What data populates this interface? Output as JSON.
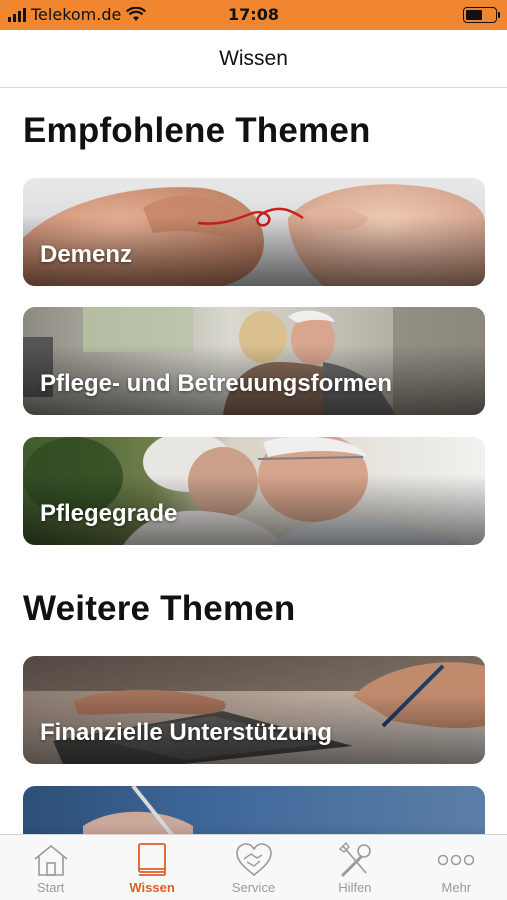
{
  "status_bar": {
    "carrier": "Telekom.de",
    "time": "17:08",
    "battery_level": 0.6,
    "bar_color": "#f0862f"
  },
  "nav": {
    "title": "Wissen"
  },
  "sections": [
    {
      "title": "Empfohlene Themen",
      "cards": [
        {
          "label": "Demenz",
          "image": "hands-with-red-thread"
        },
        {
          "label": "Pflege- und Betreuungsformen",
          "image": "elderly-couple-hugging"
        },
        {
          "label": "Pflegegrade",
          "image": "elderly-couple-embracing"
        }
      ]
    },
    {
      "title": "Weitere Themen",
      "cards": [
        {
          "label": "Finanzielle Unterstützung",
          "image": "hands-calculator-writing"
        },
        {
          "label": "",
          "image": "hands-writing-pen"
        }
      ]
    }
  ],
  "tabs": [
    {
      "label": "Start",
      "icon": "house-icon",
      "active": false
    },
    {
      "label": "Wissen",
      "icon": "book-icon",
      "active": true
    },
    {
      "label": "Service",
      "icon": "handshake-heart-icon",
      "active": false
    },
    {
      "label": "Hilfen",
      "icon": "tools-icon",
      "active": false
    },
    {
      "label": "Mehr",
      "icon": "more-dots-icon",
      "active": false
    }
  ],
  "colors": {
    "accent": "#e05d2a",
    "inactive": "#9a9a9a"
  }
}
